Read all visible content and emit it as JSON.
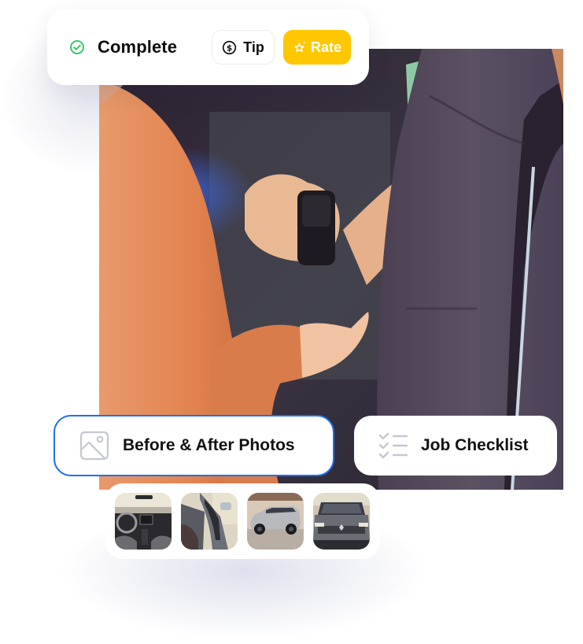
{
  "status": {
    "icon": "check-circle-icon",
    "label": "Complete",
    "color": "#22c55e"
  },
  "actions": {
    "tip": {
      "label": "Tip",
      "icon": "dollar-circle-icon"
    },
    "rate": {
      "label": "Rate",
      "icon": "star-sparkle-icon",
      "color": "#ffc700"
    }
  },
  "hero_image": {
    "alt": "Valet handing car key fob to a customer"
  },
  "features": [
    {
      "label": "Before & After Photos",
      "icon": "image-icon",
      "selected": true,
      "accent": "#1f6ff2"
    },
    {
      "label": "Job Checklist",
      "icon": "checklist-icon",
      "selected": false
    }
  ],
  "thumbnails": [
    {
      "alt": "Car interior dashboard"
    },
    {
      "alt": "Open driver door interior"
    },
    {
      "alt": "Silver SUV side view"
    },
    {
      "alt": "SUV front view"
    }
  ]
}
